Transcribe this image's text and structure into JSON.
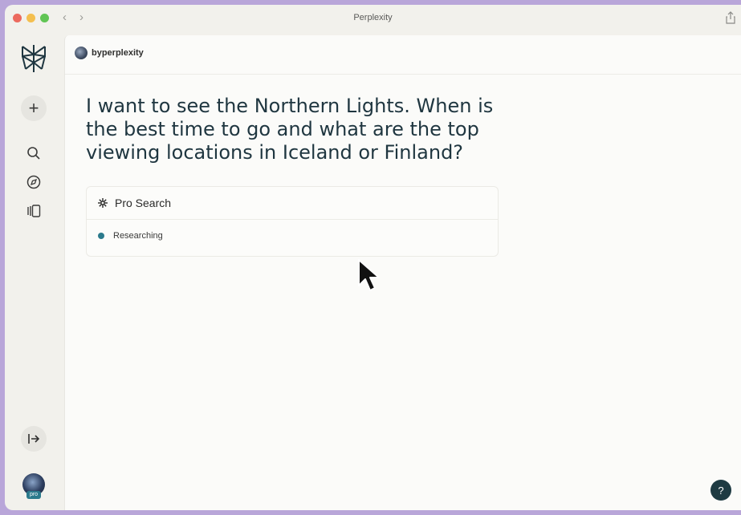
{
  "window": {
    "title": "Perplexity"
  },
  "nav": {
    "back": "‹",
    "forward": "›"
  },
  "sidebar": {
    "new_thread": "+",
    "items": [
      {
        "name": "search",
        "icon": "search-icon"
      },
      {
        "name": "discover",
        "icon": "compass-icon"
      },
      {
        "name": "library",
        "icon": "library-icon"
      }
    ],
    "user_badge": "pro"
  },
  "thread": {
    "author": "byperplexity",
    "question": "I want to see the Northern Lights. When is the best time to go and what are the top viewing locations in Iceland or Finland?",
    "pro_search": {
      "title": "Pro Search",
      "steps": [
        {
          "label": "Researching",
          "status": "in-progress"
        }
      ]
    }
  },
  "help": {
    "label": "?"
  },
  "colors": {
    "accent": "#2b7a8c",
    "heading": "#1f3640",
    "help_bg": "#1e3a42"
  }
}
